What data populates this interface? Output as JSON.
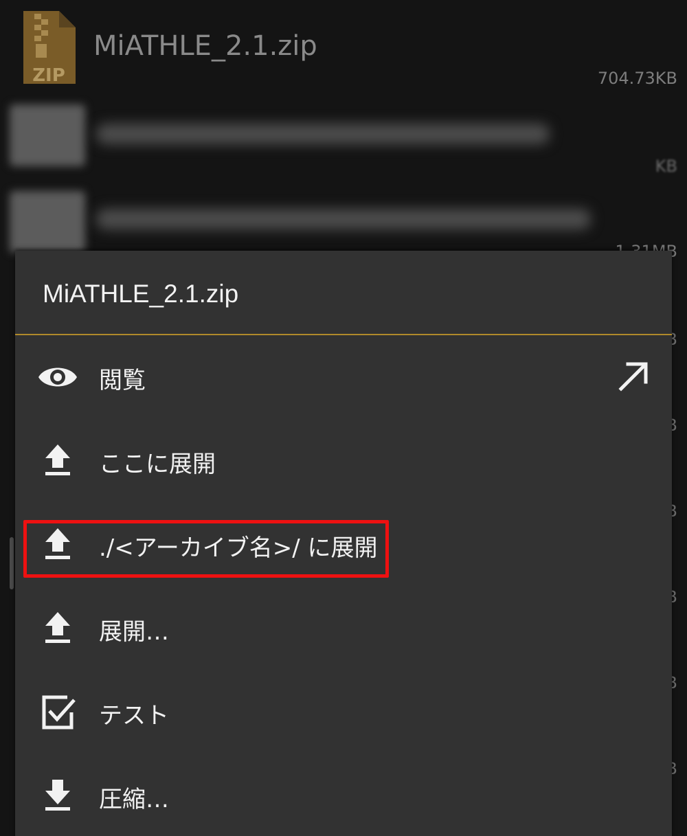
{
  "background_list": {
    "files": [
      {
        "name": "MiATHLE_2.1.zip",
        "size": "704.73KB",
        "icon": "zip-file-icon",
        "icon_label": "ZIP"
      }
    ],
    "partial_size": "1.31MB",
    "partial_sizes_blurred": [
      "KB"
    ],
    "edge_fragment": "B"
  },
  "menu": {
    "title": "MiATHLE_2.1.zip",
    "items": [
      {
        "label": "閲覧",
        "icon": "eye-icon",
        "side_icon": "open-external-arrow-icon"
      },
      {
        "label": "ここに展開",
        "icon": "extract-upload-icon"
      },
      {
        "label": "./<アーカイブ名>/ に展開",
        "icon": "extract-upload-icon",
        "highlighted": true
      },
      {
        "label": "展開…",
        "icon": "extract-upload-icon"
      },
      {
        "label": "テスト",
        "icon": "checkbox-icon"
      },
      {
        "label": "圧縮…",
        "icon": "download-compress-icon"
      }
    ]
  },
  "colors": {
    "sheet_bg": "#323232",
    "divider": "#b08a2a",
    "highlight_border": "#ee1111",
    "text": "#f2f2f2"
  }
}
